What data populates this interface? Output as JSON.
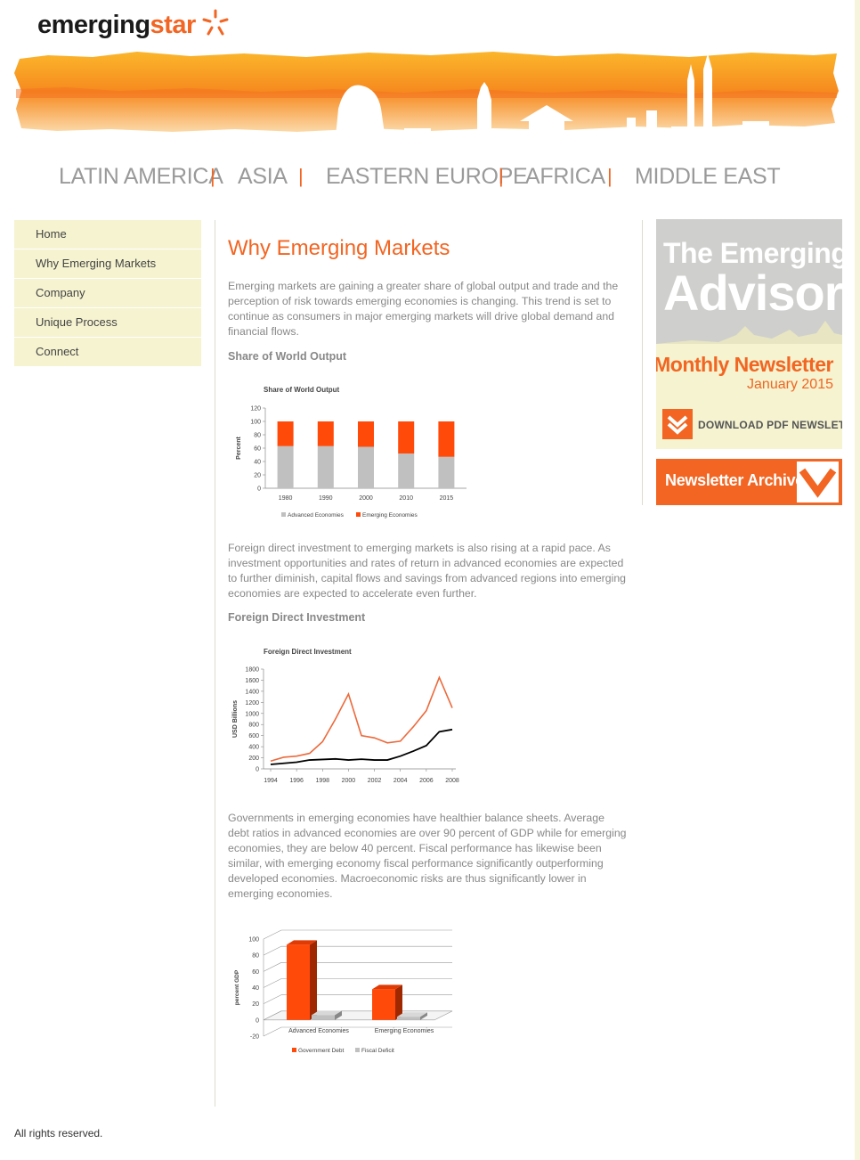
{
  "logo": {
    "part1": "emerging",
    "part2": "star"
  },
  "regions": [
    "LATIN AMERICA",
    "ASIA",
    "EASTERN EUROPE",
    "AFRICA",
    "MIDDLE EAST"
  ],
  "region_separator": "|",
  "sidenav": [
    "Home",
    "Why Emerging Markets",
    "Company",
    "Unique Process",
    "Connect"
  ],
  "main": {
    "title": "Why Emerging Markets",
    "para1": "Emerging markets are gaining a greater share of global output and trade and the perception of risk towards emerging economies is changing. This trend is set to continue as consumers in major emerging markets will drive global demand and financial flows.",
    "sub1": "Share of World Output",
    "para2": "Foreign direct investment to emerging markets is also rising at a rapid pace. As investment opportunities and rates of return in advanced economies are expected to further diminish, capital flows and savings from advanced regions into emerging economies are expected to accelerate even further.",
    "sub2": "Foreign Direct Investment",
    "para3": "Governments in emerging economies have healthier balance sheets. Average debt ratios in advanced economies are over 90 percent of GDP while for emerging economies, they are below 40 percent. Fiscal performance has likewise been similar, with emerging economy fiscal performance significantly outperforming developed economies. Macroeconomic risks are thus significantly lower in emerging economies."
  },
  "advisor": {
    "line1": "The Emerging",
    "line2": "Advisor",
    "monthly": "Monthly Newsletter",
    "date": "January 2015",
    "download": "DOWNLOAD PDF NEWSLETTER"
  },
  "archive": {
    "label": "Newsletter Archive"
  },
  "footer": {
    "text": "All rights reserved."
  },
  "colors": {
    "accent": "#f26522",
    "advanced": "#c0c0c0",
    "emerging": "#ff4a0a",
    "nav_bg": "#f5f3d0"
  },
  "chart_data": [
    {
      "type": "bar",
      "title": "Share of World Output",
      "ylabel": "Percent",
      "ylim": [
        0,
        120
      ],
      "yticks": [
        0,
        20,
        40,
        60,
        80,
        100,
        120
      ],
      "stacked": true,
      "categories": [
        "1980",
        "1990",
        "2000",
        "2010",
        "2015"
      ],
      "series": [
        {
          "name": "Advanced Economies",
          "values": [
            63,
            63,
            62,
            52,
            47
          ]
        },
        {
          "name": "Emerging Economies",
          "values": [
            37,
            37,
            38,
            48,
            53
          ]
        }
      ],
      "legend": "bottom"
    },
    {
      "type": "line",
      "title": "Foreign Direct Investment",
      "ylabel": "USD Billions",
      "ylim": [
        0,
        1800
      ],
      "yticks": [
        0,
        200,
        400,
        600,
        800,
        1000,
        1200,
        1400,
        1600,
        1800
      ],
      "xlim": [
        1994,
        2008
      ],
      "xticks": [
        "1994",
        "1996",
        "1998",
        "2000",
        "2002",
        "2004",
        "2006",
        "2008"
      ],
      "series": [
        {
          "color": "#ec6a3c",
          "x": [
            1994,
            1995,
            1996,
            1997,
            1998,
            1999,
            2000,
            2001,
            2002,
            2003,
            2004,
            2005,
            2006,
            2007,
            2008
          ],
          "values": [
            140,
            210,
            230,
            280,
            490,
            900,
            1350,
            600,
            560,
            470,
            500,
            760,
            1050,
            1650,
            1100
          ]
        },
        {
          "color": "#000000",
          "x": [
            1994,
            1995,
            1996,
            1997,
            1998,
            1999,
            2000,
            2001,
            2002,
            2003,
            2004,
            2005,
            2006,
            2007,
            2008
          ],
          "values": [
            80,
            100,
            120,
            160,
            170,
            180,
            160,
            175,
            160,
            160,
            230,
            320,
            420,
            670,
            710
          ]
        }
      ],
      "legend": "none"
    },
    {
      "type": "bar",
      "title": "",
      "ylabel": "percent GDP",
      "ylim": [
        -20,
        100
      ],
      "yticks": [
        -20,
        0,
        20,
        40,
        60,
        80,
        100
      ],
      "categories": [
        "Advanced Economies",
        "Emerging Economies"
      ],
      "series": [
        {
          "name": "Government Debt",
          "values": [
            93,
            38
          ]
        },
        {
          "name": "Fiscal Deficit",
          "values": [
            6,
            4
          ]
        }
      ],
      "legend": "bottom"
    }
  ]
}
